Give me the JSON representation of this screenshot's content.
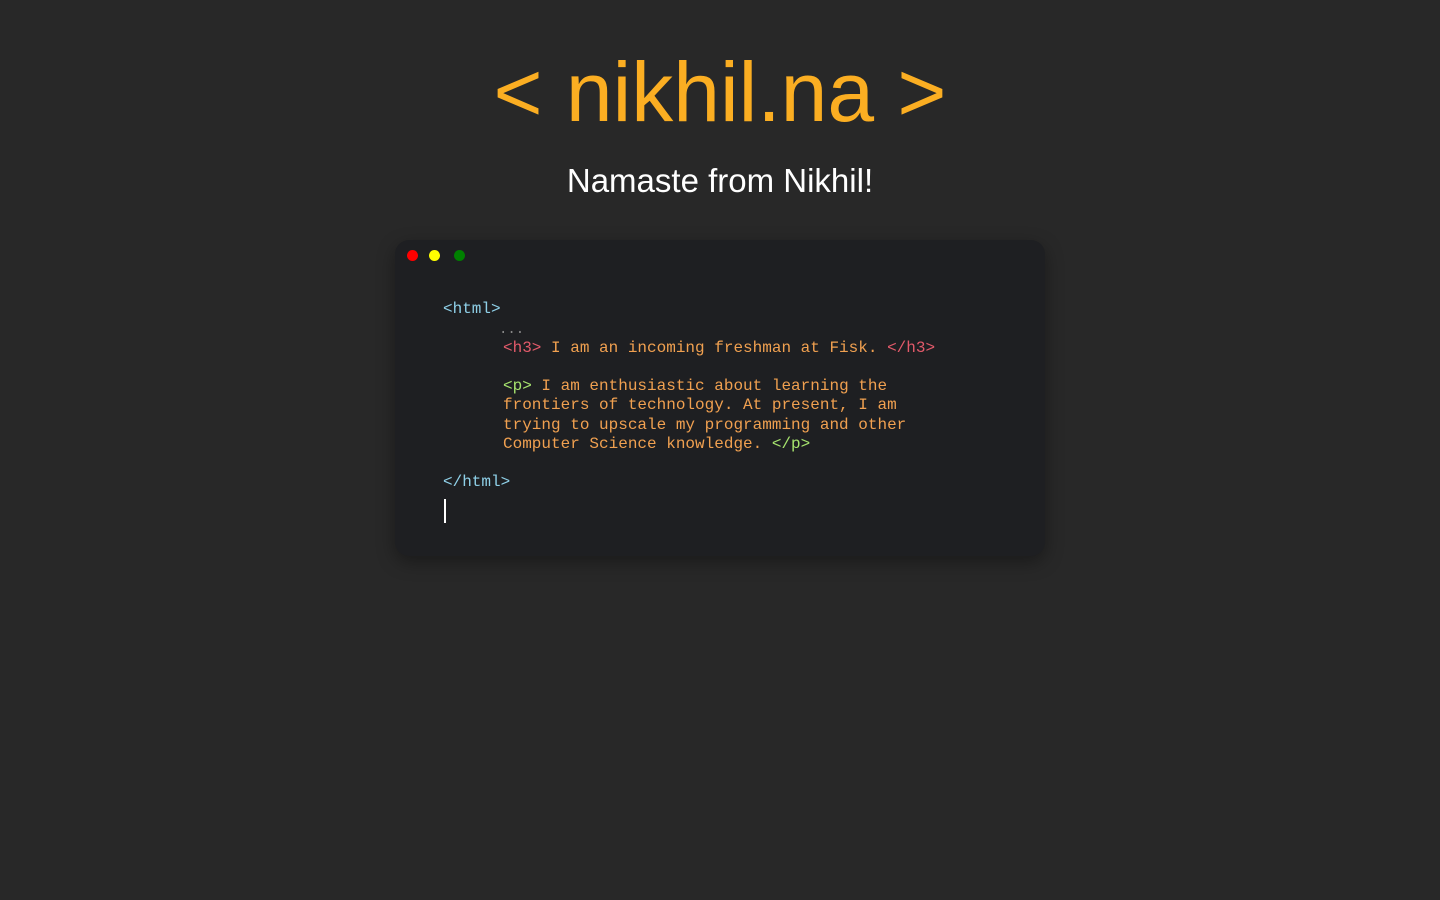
{
  "header": {
    "title": "< nikhil.na >",
    "tagline": "Namaste from Nikhil!"
  },
  "terminal": {
    "window_controls": [
      "close",
      "minimize",
      "maximize"
    ],
    "html_open": "<html>",
    "ellipsis": "...",
    "h3_open": "<h3>",
    "h3_text": " I am an incoming freshman at Fisk. ",
    "h3_close": "</h3>",
    "p_open": "<p>",
    "p_line1": " I am enthusiastic about learning the",
    "p_line2": "frontiers of technology. At present, I am",
    "p_line3": "trying to upscale my programming and other",
    "p_line4": "Computer Science knowledge. ",
    "p_close": "</p>",
    "html_close": "</html>"
  },
  "colors": {
    "background": "#282828",
    "title": "#fbae22",
    "tagline": "#ffffff",
    "terminal_bg": "#1e1f22",
    "html_tag": "#8fd0e8",
    "h3_tag": "#e35a6a",
    "p_tag": "#a6e36e",
    "body_text": "#f0a050",
    "ellipsis": "#888888",
    "dot_red": "#ff0000",
    "dot_yellow": "#ffff00",
    "dot_green": "#008000"
  }
}
